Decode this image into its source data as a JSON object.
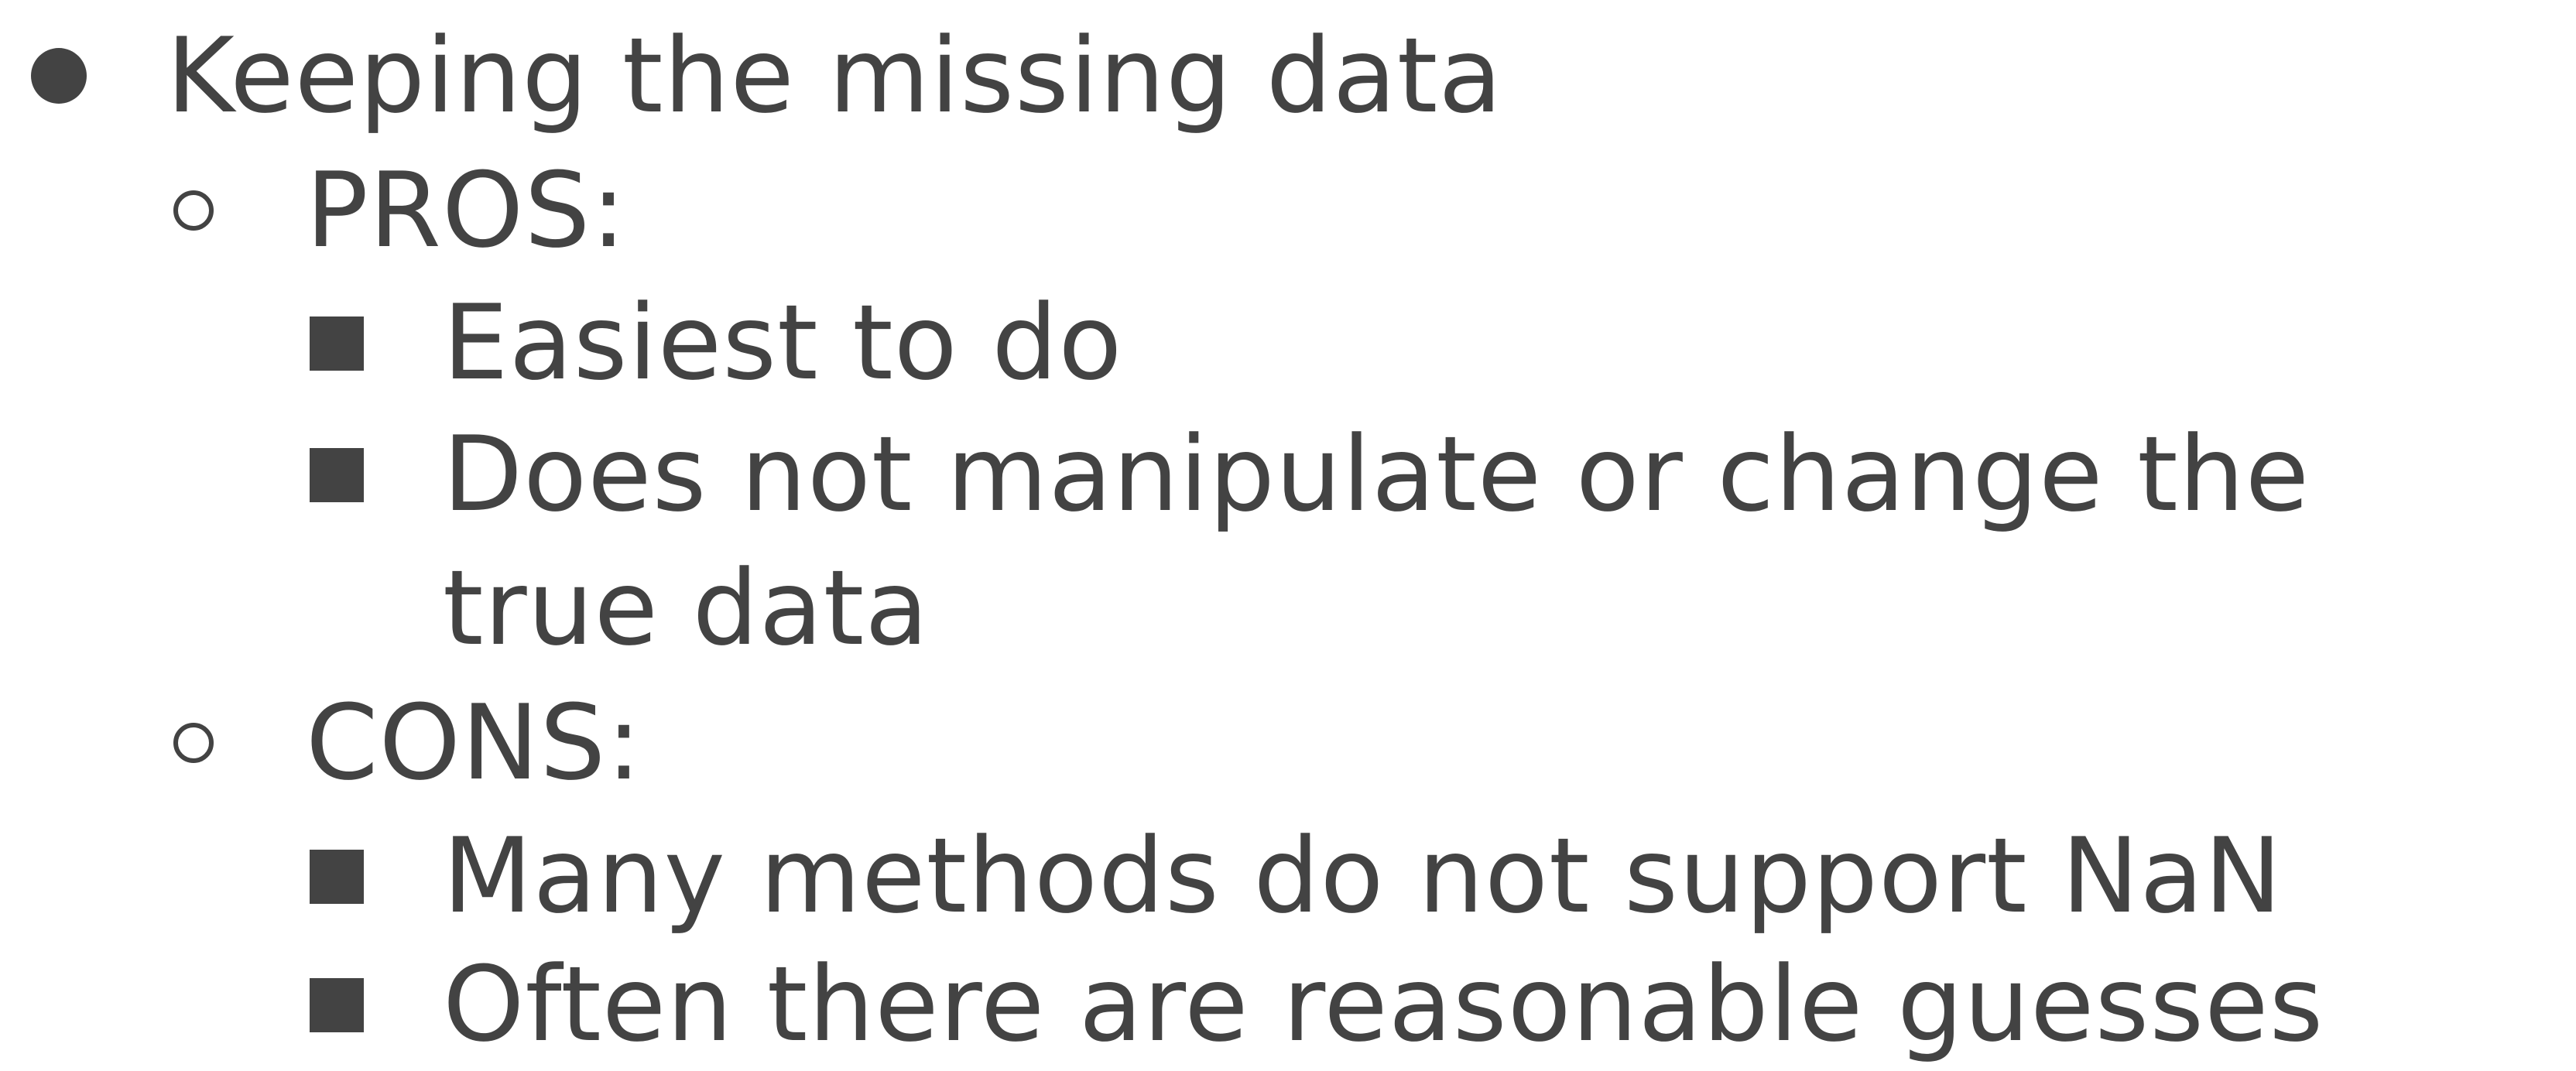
{
  "bullets": {
    "main": "Keeping the missing data",
    "pros": {
      "label": "PROS:",
      "items": [
        "Easiest to do",
        "Does not manipulate or change the",
        "true data"
      ]
    },
    "cons": {
      "label": "CONS:",
      "items": [
        "Many methods do not support NaN",
        "Often there are reasonable guesses"
      ]
    }
  }
}
